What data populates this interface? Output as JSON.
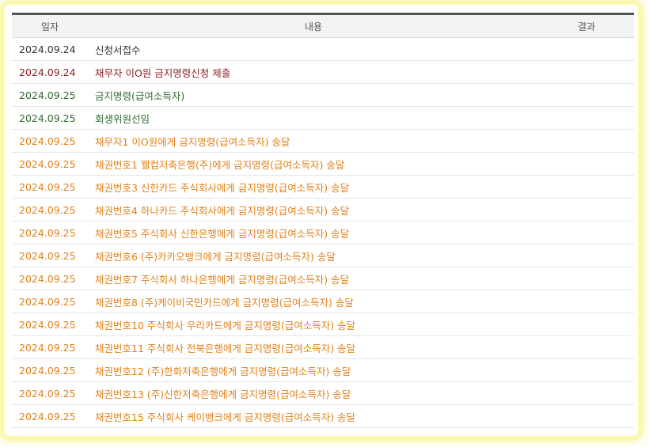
{
  "header": {
    "date": "일자",
    "content": "내용",
    "result": "결과"
  },
  "colors": {
    "black": "#333333",
    "maroon": "#8b1f24",
    "green": "#2f6b2f",
    "orange": "#e1821a"
  },
  "rows": [
    {
      "date": "2024.09.24",
      "content": "신청서접수",
      "result": "",
      "color": "black"
    },
    {
      "date": "2024.09.24",
      "content": "채무자 이O원 금지명령신청 제출",
      "result": "",
      "color": "maroon"
    },
    {
      "date": "2024.09.25",
      "content": "금지명령(급여소득자)",
      "result": "",
      "color": "green"
    },
    {
      "date": "2024.09.25",
      "content": "회생위원선임",
      "result": "",
      "color": "green"
    },
    {
      "date": "2024.09.25",
      "content": "채무자1 이O원에게 금지명령(급여소득자) 송달",
      "result": "",
      "color": "orange"
    },
    {
      "date": "2024.09.25",
      "content": "채권번호1 웰컴저축은행(주)에게 금지명령(급여소득자) 송달",
      "result": "",
      "color": "orange"
    },
    {
      "date": "2024.09.25",
      "content": "채권번호3 신한카드 주식회사에게 금지명령(급여소득자) 송달",
      "result": "",
      "color": "orange"
    },
    {
      "date": "2024.09.25",
      "content": "채권번호4 하나카드 주식회사에게 금지명령(급여소득자) 송달",
      "result": "",
      "color": "orange"
    },
    {
      "date": "2024.09.25",
      "content": "채권번호5 주식회사 신한은행에게 금지명령(급여소득자) 송달",
      "result": "",
      "color": "orange"
    },
    {
      "date": "2024.09.25",
      "content": "채권번호6 (주)카카오뱅크에게 금지명령(급여소득자) 송달",
      "result": "",
      "color": "orange"
    },
    {
      "date": "2024.09.25",
      "content": "채권번호7 주식회사 하나은행에게 금지명령(급여소득자) 송달",
      "result": "",
      "color": "orange"
    },
    {
      "date": "2024.09.25",
      "content": "채권번호8 (주)케이비국민카드에게 금지명령(급여소득자) 송달",
      "result": "",
      "color": "orange"
    },
    {
      "date": "2024.09.25",
      "content": "채권번호10 주식회사 우리카드에게 금지명령(급여소득자) 송달",
      "result": "",
      "color": "orange"
    },
    {
      "date": "2024.09.25",
      "content": "채권번호11 주식회사 전북은행에게 금지명령(급여소득자) 송달",
      "result": "",
      "color": "orange"
    },
    {
      "date": "2024.09.25",
      "content": "채권번호12 (주)한화저축은행에게 금지명령(급여소득자) 송달",
      "result": "",
      "color": "orange"
    },
    {
      "date": "2024.09.25",
      "content": "채권번호13 (주)신한저축은행에게 금지명령(급여소득자) 송달",
      "result": "",
      "color": "orange"
    },
    {
      "date": "2024.09.25",
      "content": "채권번호15 주식회사 케이뱅크에게 금지명령(급여소득자) 송달",
      "result": "",
      "color": "orange"
    }
  ]
}
